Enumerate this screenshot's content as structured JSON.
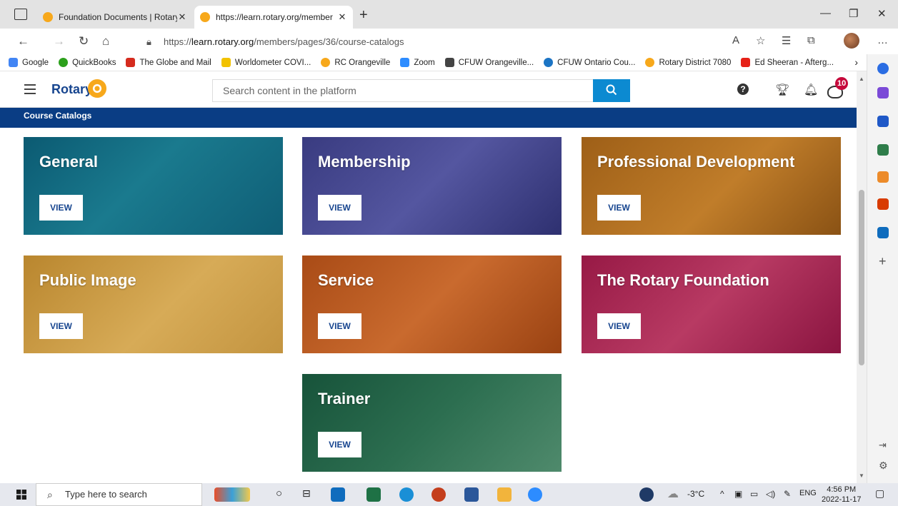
{
  "browser": {
    "tabs": [
      {
        "title": "Foundation Documents | Rotary",
        "close": "✕"
      },
      {
        "title": "https://learn.rotary.org/member",
        "close": "✕"
      }
    ],
    "new_tab": "+",
    "url_prefix": "https://",
    "url_host": "learn.rotary.org",
    "url_path": "/members/pages/36/course-catalogs",
    "bookmarks": [
      {
        "label": "Google",
        "color": "#4285f4"
      },
      {
        "label": "QuickBooks",
        "color": "#2ca01c"
      },
      {
        "label": "The Globe and Mail",
        "color": "#d52b1e"
      },
      {
        "label": "Worldometer COVI...",
        "color": "#f2c200"
      },
      {
        "label": "RC Orangeville",
        "color": "#f7a81b"
      },
      {
        "label": "Zoom",
        "color": "#2d8cff"
      },
      {
        "label": "CFUW Orangeville...",
        "color": "#444444"
      },
      {
        "label": "CFUW Ontario Cou...",
        "color": "#1b74c4"
      },
      {
        "label": "Rotary District 7080",
        "color": "#f7a81b"
      },
      {
        "label": "Ed Sheeran - Afterg...",
        "color": "#e62117"
      }
    ]
  },
  "header": {
    "logo": "Rotary",
    "search_placeholder": "Search content in the platform",
    "notification_count": "10"
  },
  "breadcrumb": "Course Catalogs",
  "cards": [
    {
      "title": "General",
      "view": "VIEW",
      "color": "#0d5f79"
    },
    {
      "title": "Membership",
      "view": "VIEW",
      "color": "#3d3f86"
    },
    {
      "title": "Professional Development",
      "view": "VIEW",
      "color": "#a8661a"
    },
    {
      "title": "Public Image",
      "view": "VIEW",
      "color": "#c7973a"
    },
    {
      "title": "Service",
      "view": "VIEW",
      "color": "#b5531a"
    },
    {
      "title": "The Rotary Foundation",
      "view": "VIEW",
      "color": "#a01c4b"
    },
    {
      "title": "Trainer",
      "view": "VIEW",
      "color": "#1d5a3c"
    }
  ],
  "taskbar": {
    "search_placeholder": "Type here to search",
    "temperature": "-3°C",
    "language": "ENG",
    "time": "4:56 PM",
    "date": "2022-11-17"
  }
}
